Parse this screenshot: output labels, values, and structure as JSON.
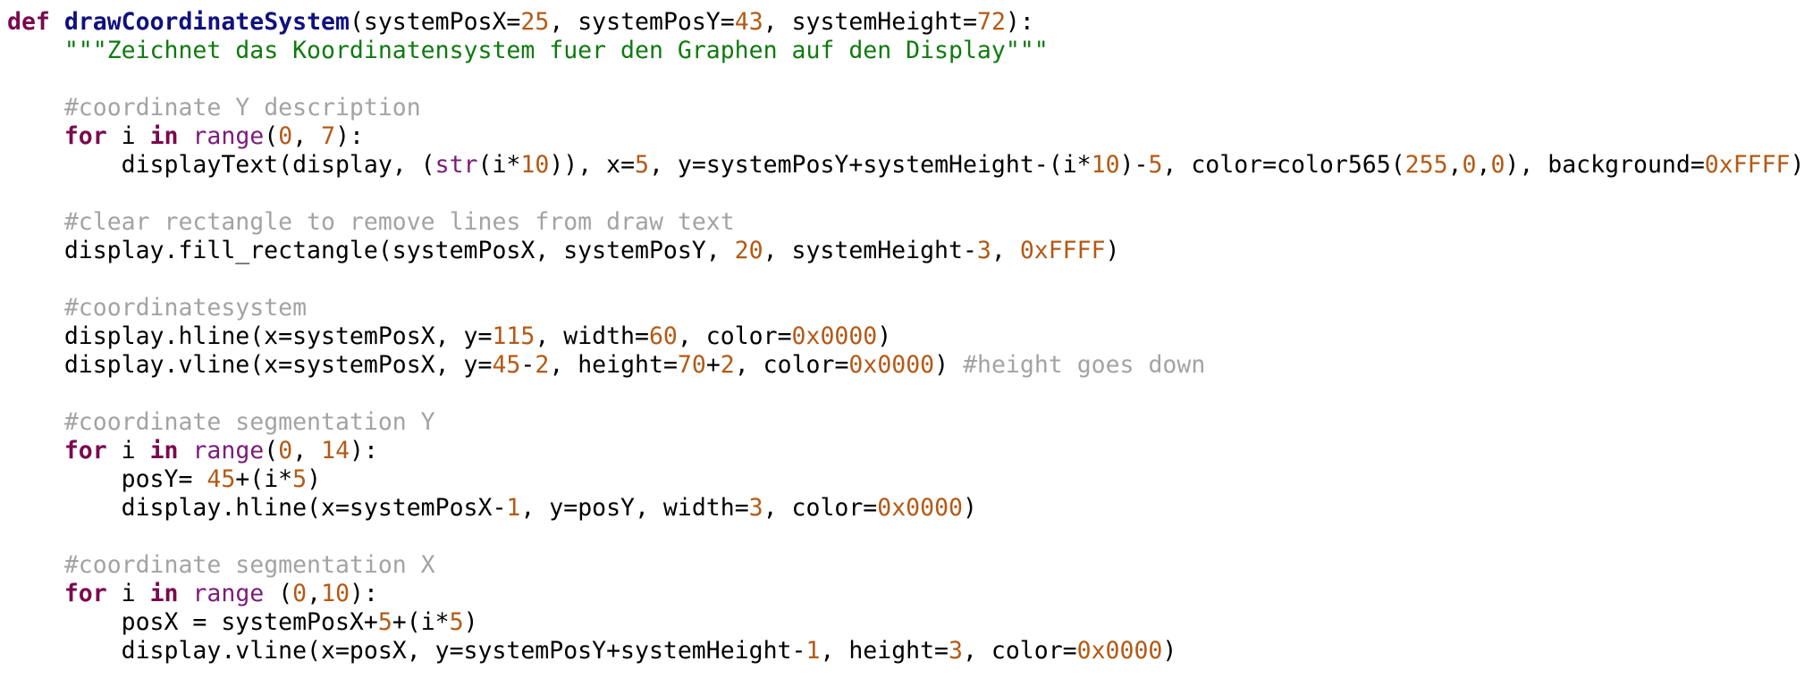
{
  "editor": {
    "language": "python",
    "colors": {
      "keyword": "#7a0a4e",
      "function_name": "#10107e",
      "identifier": "#000000",
      "number": "#b35a16",
      "string": "#0f7a0f",
      "comment": "#a3a3a3",
      "builtin": "#7a1c7a"
    },
    "lines": [
      [
        {
          "t": "kw",
          "v": "def"
        },
        {
          "t": "id",
          "v": " "
        },
        {
          "t": "fn",
          "v": "drawCoordinateSystem"
        },
        {
          "t": "id",
          "v": "(systemPosX="
        },
        {
          "t": "num",
          "v": "25"
        },
        {
          "t": "id",
          "v": ", systemPosY="
        },
        {
          "t": "num",
          "v": "43"
        },
        {
          "t": "id",
          "v": ", systemHeight="
        },
        {
          "t": "num",
          "v": "72"
        },
        {
          "t": "id",
          "v": "):"
        }
      ],
      [
        {
          "t": "id",
          "v": "    "
        },
        {
          "t": "str",
          "v": "\"\"\"Zeichnet das Koordinatensystem fuer den Graphen auf den Display\"\"\""
        }
      ],
      [],
      [
        {
          "t": "id",
          "v": "    "
        },
        {
          "t": "com",
          "v": "#coordinate Y description"
        }
      ],
      [
        {
          "t": "id",
          "v": "    "
        },
        {
          "t": "kw",
          "v": "for"
        },
        {
          "t": "id",
          "v": " i "
        },
        {
          "t": "kw",
          "v": "in"
        },
        {
          "t": "id",
          "v": " "
        },
        {
          "t": "bi",
          "v": "range"
        },
        {
          "t": "id",
          "v": "("
        },
        {
          "t": "num",
          "v": "0"
        },
        {
          "t": "id",
          "v": ", "
        },
        {
          "t": "num",
          "v": "7"
        },
        {
          "t": "id",
          "v": "):"
        }
      ],
      [
        {
          "t": "id",
          "v": "        displayText(display, ("
        },
        {
          "t": "bi",
          "v": "str"
        },
        {
          "t": "id",
          "v": "(i*"
        },
        {
          "t": "num",
          "v": "10"
        },
        {
          "t": "id",
          "v": ")), x="
        },
        {
          "t": "num",
          "v": "5"
        },
        {
          "t": "id",
          "v": ", y=systemPosY+systemHeight-(i*"
        },
        {
          "t": "num",
          "v": "10"
        },
        {
          "t": "id",
          "v": ")-"
        },
        {
          "t": "num",
          "v": "5"
        },
        {
          "t": "id",
          "v": ", color=color565("
        },
        {
          "t": "num",
          "v": "255"
        },
        {
          "t": "id",
          "v": ","
        },
        {
          "t": "num",
          "v": "0"
        },
        {
          "t": "id",
          "v": ","
        },
        {
          "t": "num",
          "v": "0"
        },
        {
          "t": "id",
          "v": "), background="
        },
        {
          "t": "num",
          "v": "0xFFFF"
        },
        {
          "t": "id",
          "v": ")"
        }
      ],
      [],
      [
        {
          "t": "id",
          "v": "    "
        },
        {
          "t": "com",
          "v": "#clear rectangle to remove lines from draw text"
        }
      ],
      [
        {
          "t": "id",
          "v": "    display.fill_rectangle(systemPosX, systemPosY, "
        },
        {
          "t": "num",
          "v": "20"
        },
        {
          "t": "id",
          "v": ", systemHeight-"
        },
        {
          "t": "num",
          "v": "3"
        },
        {
          "t": "id",
          "v": ", "
        },
        {
          "t": "num",
          "v": "0xFFFF"
        },
        {
          "t": "id",
          "v": ")"
        }
      ],
      [],
      [
        {
          "t": "id",
          "v": "    "
        },
        {
          "t": "com",
          "v": "#coordinatesystem"
        }
      ],
      [
        {
          "t": "id",
          "v": "    display.hline(x=systemPosX, y="
        },
        {
          "t": "num",
          "v": "115"
        },
        {
          "t": "id",
          "v": ", width="
        },
        {
          "t": "num",
          "v": "60"
        },
        {
          "t": "id",
          "v": ", color="
        },
        {
          "t": "num",
          "v": "0x0000"
        },
        {
          "t": "id",
          "v": ")"
        }
      ],
      [
        {
          "t": "id",
          "v": "    display.vline(x=systemPosX, y="
        },
        {
          "t": "num",
          "v": "45"
        },
        {
          "t": "id",
          "v": "-"
        },
        {
          "t": "num",
          "v": "2"
        },
        {
          "t": "id",
          "v": ", height="
        },
        {
          "t": "num",
          "v": "70"
        },
        {
          "t": "id",
          "v": "+"
        },
        {
          "t": "num",
          "v": "2"
        },
        {
          "t": "id",
          "v": ", color="
        },
        {
          "t": "num",
          "v": "0x0000"
        },
        {
          "t": "id",
          "v": ") "
        },
        {
          "t": "com",
          "v": "#height goes down"
        }
      ],
      [],
      [
        {
          "t": "id",
          "v": "    "
        },
        {
          "t": "com",
          "v": "#coordinate segmentation Y"
        }
      ],
      [
        {
          "t": "id",
          "v": "    "
        },
        {
          "t": "kw",
          "v": "for"
        },
        {
          "t": "id",
          "v": " i "
        },
        {
          "t": "kw",
          "v": "in"
        },
        {
          "t": "id",
          "v": " "
        },
        {
          "t": "bi",
          "v": "range"
        },
        {
          "t": "id",
          "v": "("
        },
        {
          "t": "num",
          "v": "0"
        },
        {
          "t": "id",
          "v": ", "
        },
        {
          "t": "num",
          "v": "14"
        },
        {
          "t": "id",
          "v": "):"
        }
      ],
      [
        {
          "t": "id",
          "v": "        posY= "
        },
        {
          "t": "num",
          "v": "45"
        },
        {
          "t": "id",
          "v": "+(i*"
        },
        {
          "t": "num",
          "v": "5"
        },
        {
          "t": "id",
          "v": ")"
        }
      ],
      [
        {
          "t": "id",
          "v": "        display.hline(x=systemPosX-"
        },
        {
          "t": "num",
          "v": "1"
        },
        {
          "t": "id",
          "v": ", y=posY, width="
        },
        {
          "t": "num",
          "v": "3"
        },
        {
          "t": "id",
          "v": ", color="
        },
        {
          "t": "num",
          "v": "0x0000"
        },
        {
          "t": "id",
          "v": ")"
        }
      ],
      [],
      [
        {
          "t": "id",
          "v": "    "
        },
        {
          "t": "com",
          "v": "#coordinate segmentation X"
        }
      ],
      [
        {
          "t": "id",
          "v": "    "
        },
        {
          "t": "kw",
          "v": "for"
        },
        {
          "t": "id",
          "v": " i "
        },
        {
          "t": "kw",
          "v": "in"
        },
        {
          "t": "id",
          "v": " "
        },
        {
          "t": "bi",
          "v": "range"
        },
        {
          "t": "id",
          "v": " ("
        },
        {
          "t": "num",
          "v": "0"
        },
        {
          "t": "id",
          "v": ","
        },
        {
          "t": "num",
          "v": "10"
        },
        {
          "t": "id",
          "v": "):"
        }
      ],
      [
        {
          "t": "id",
          "v": "        posX = systemPosX+"
        },
        {
          "t": "num",
          "v": "5"
        },
        {
          "t": "id",
          "v": "+(i*"
        },
        {
          "t": "num",
          "v": "5"
        },
        {
          "t": "id",
          "v": ")"
        }
      ],
      [
        {
          "t": "id",
          "v": "        display.vline(x=posX, y=systemPosY+systemHeight-"
        },
        {
          "t": "num",
          "v": "1"
        },
        {
          "t": "id",
          "v": ", height="
        },
        {
          "t": "num",
          "v": "3"
        },
        {
          "t": "id",
          "v": ", color="
        },
        {
          "t": "num",
          "v": "0x0000"
        },
        {
          "t": "id",
          "v": ")"
        }
      ]
    ]
  }
}
